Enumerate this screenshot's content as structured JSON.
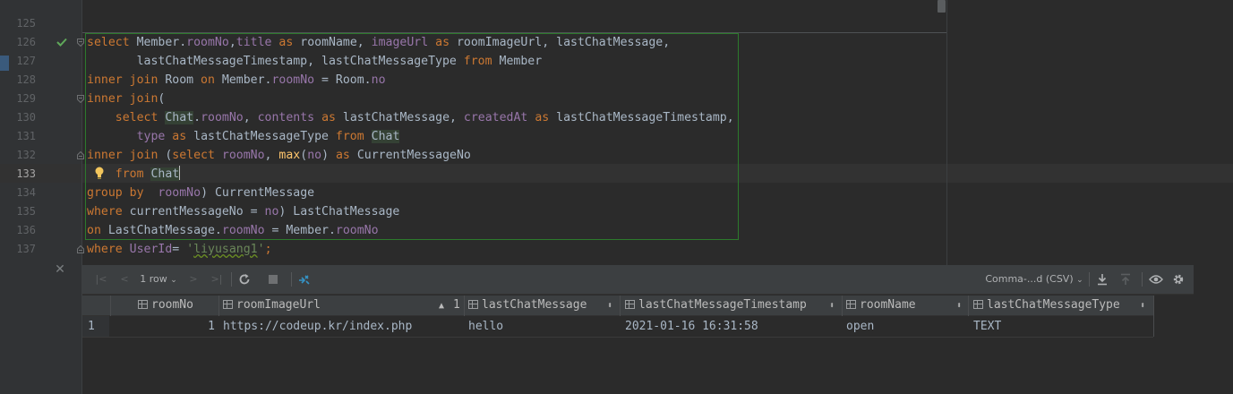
{
  "editor": {
    "line_numbers": [
      "125",
      "126",
      "127",
      "128",
      "129",
      "130",
      "131",
      "132",
      "133",
      "134",
      "135",
      "136",
      "137"
    ],
    "active_line": "133"
  },
  "results": {
    "toolbar": {
      "first_page": "|<",
      "prev_page": "<",
      "rows_label": "1 row",
      "next_page": ">",
      "last_page": ">|",
      "format_label": "Comma-...d (CSV)"
    },
    "columns": [
      {
        "name": "roomNo"
      },
      {
        "name": "roomImageUrl",
        "sort_order": "1"
      },
      {
        "name": "lastChatMessage"
      },
      {
        "name": "lastChatMessageTimestamp"
      },
      {
        "name": "roomName"
      },
      {
        "name": "lastChatMessageType"
      }
    ],
    "rows": [
      {
        "row_num": "1",
        "cells": [
          "1",
          "https://codeup.kr/index.php",
          "hello",
          "2021-01-16 16:31:58",
          "open",
          "TEXT"
        ]
      }
    ]
  },
  "colors": {
    "keyword": "#cc7832",
    "field": "#9876aa",
    "function": "#ffc66d",
    "string": "#6a8759",
    "text": "#a9b7c6",
    "background": "#2b2b2b",
    "statement_border": "#2c7a2c"
  }
}
